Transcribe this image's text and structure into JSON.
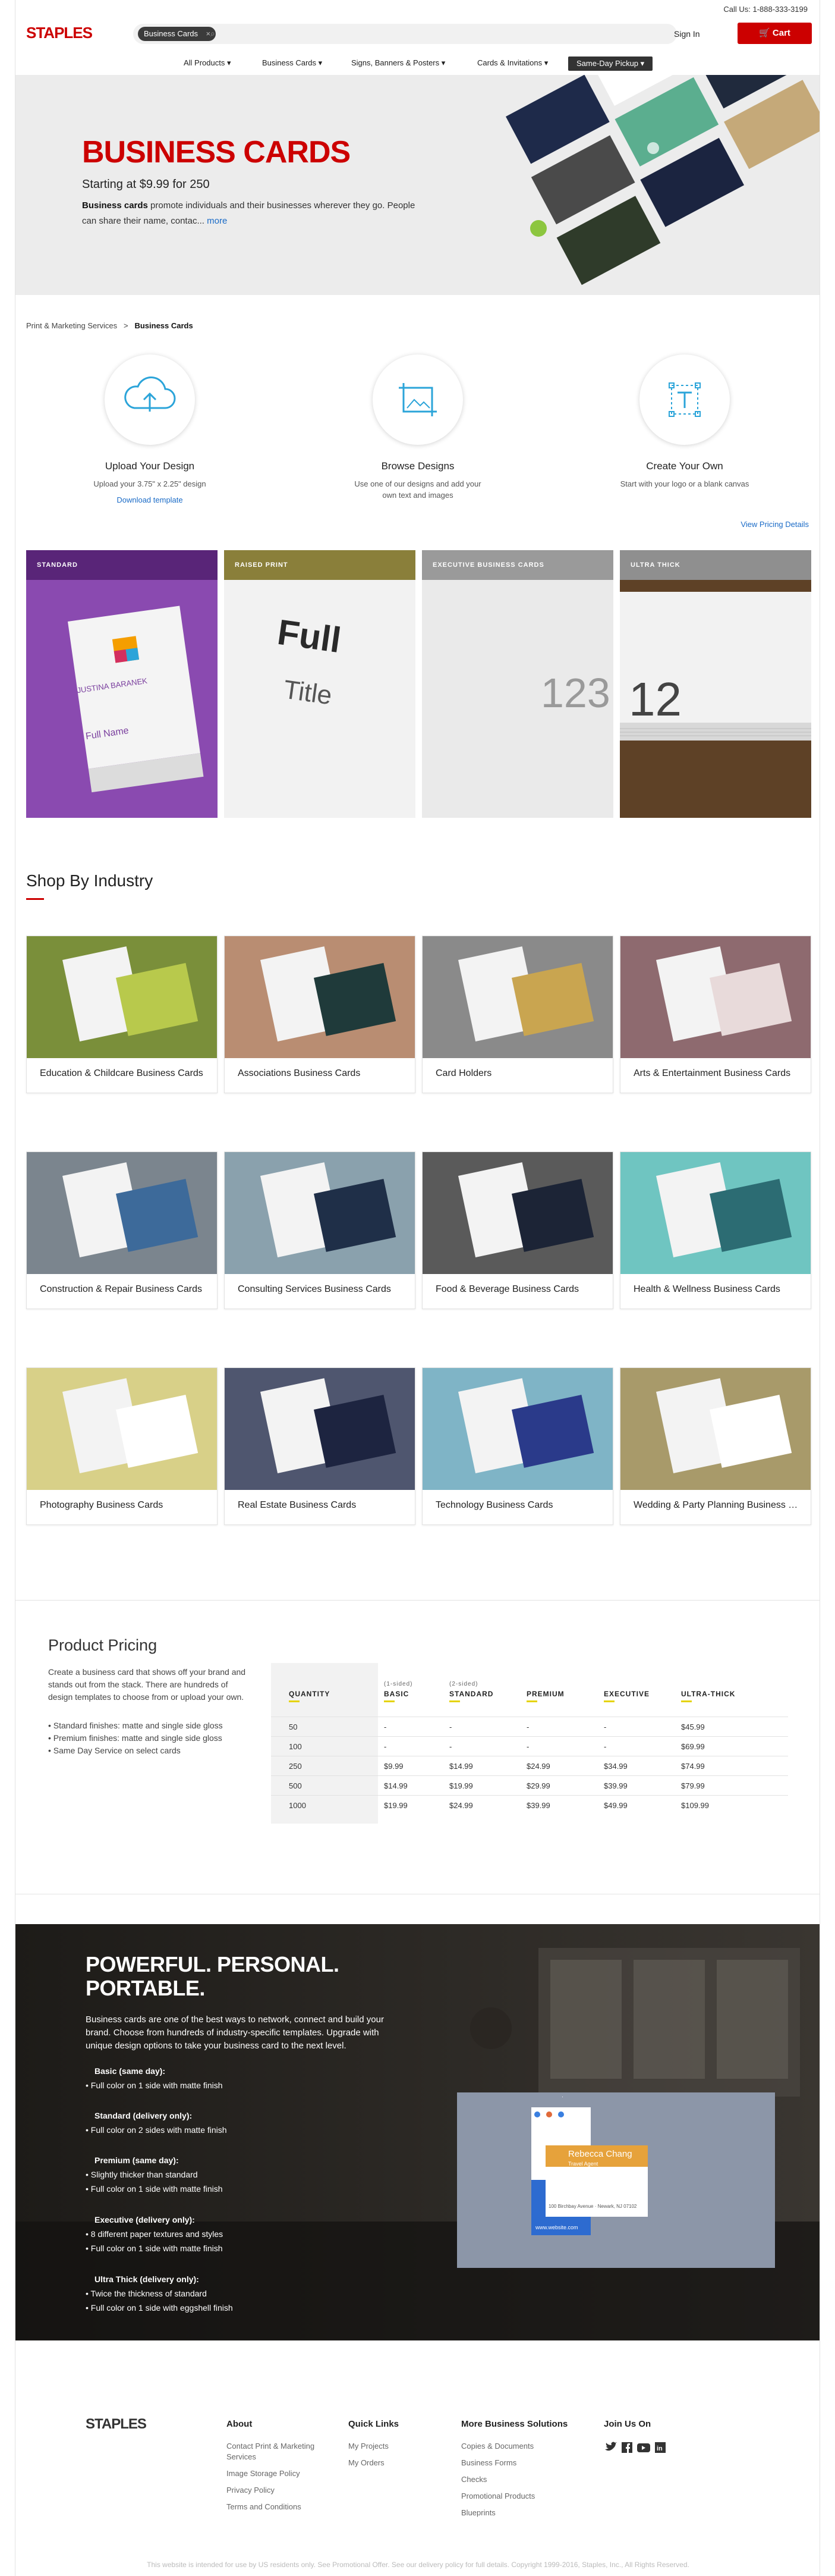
{
  "header": {
    "call_us": "Call Us: 1-888-333-3199",
    "logo": "STAPLES",
    "search_chip": "Business Cards",
    "search_chip_clear": "×",
    "sign_in": "Sign In",
    "cart": "Cart"
  },
  "nav": {
    "items": [
      "All Products ▾",
      "Business Cards ▾",
      "Signs, Banners & Posters ▾",
      "Cards & Invitations ▾"
    ],
    "same_day": "Same-Day Pickup ▾"
  },
  "hero": {
    "title": "BUSINESS CARDS",
    "price": "Starting at $9.99 for 250",
    "desc_bold": "Business cards",
    "desc_rest": " promote individuals and their businesses wherever they go. People can share their name, contac...",
    "more": "more"
  },
  "breadcrumb": {
    "parent": "Print & Marketing Services",
    "sep": ">",
    "current": "Business Cards"
  },
  "options": [
    {
      "title": "Upload Your Design",
      "sub": "Upload your 3.75\" x 2.25\" design",
      "link": "Download template"
    },
    {
      "title": "Browse Designs",
      "sub": "Use one of our designs and add your own text and images",
      "link": ""
    },
    {
      "title": "Create Your Own",
      "sub": "Start with your logo or a blank canvas",
      "link": ""
    }
  ],
  "view_pricing": "View Pricing Details",
  "paper": [
    "STANDARD",
    "RAISED PRINT",
    "EXECUTIVE BUSINESS CARDS",
    "ULTRA THICK"
  ],
  "paper_sample": {
    "name": "JUSTINA BARANEK",
    "full": "Full",
    "title": "Title",
    "name2": "Full Name",
    "num": "123",
    "num2": "12"
  },
  "industry": {
    "title": "Shop By Industry",
    "items": [
      "Education & Childcare Business Cards",
      "Associations Business Cards",
      "Card Holders",
      "Arts & Entertainment Business Cards",
      "Construction & Repair Business Cards",
      "Consulting Services Business Cards",
      "Food & Beverage Business Cards",
      "Health & Wellness Business Cards",
      "Photography Business Cards",
      "Real Estate Business Cards",
      "Technology Business Cards",
      "Wedding & Party Planning Business Cards"
    ]
  },
  "pricing": {
    "title": "Product Pricing",
    "desc": "Create a business card that shows off your brand and stands out from the stack. There are hundreds of design templates to choose from or upload your own.",
    "bullets": [
      "• Standard finishes: matte and single side gloss",
      "• Premium finishes: matte and single side gloss",
      "• Same Day Service on select cards"
    ],
    "headers": [
      "QUANTITY",
      "BASIC",
      "STANDARD",
      "PREMIUM",
      "EXECUTIVE",
      "ULTRA-THICK"
    ],
    "subheaders": [
      "",
      "(1-sided)",
      "(2-sided)",
      "",
      "",
      ""
    ],
    "rows": [
      [
        "50",
        "-",
        "-",
        "-",
        "-",
        "$45.99"
      ],
      [
        "100",
        "-",
        "-",
        "-",
        "-",
        "$69.99"
      ],
      [
        "250",
        "$9.99",
        "$14.99",
        "$24.99",
        "$34.99",
        "$74.99"
      ],
      [
        "500",
        "$14.99",
        "$19.99",
        "$29.99",
        "$39.99",
        "$79.99"
      ],
      [
        "1000",
        "$19.99",
        "$24.99",
        "$39.99",
        "$49.99",
        "$109.99"
      ]
    ]
  },
  "powerful": {
    "title": "POWERFUL. PERSONAL. PORTABLE.",
    "desc": "Business cards are one of the best ways to network, connect and build your brand. Choose from hundreds of industry-specific templates. Upgrade with unique design options to take your business card to the next level.",
    "groups": [
      {
        "name": "Basic (same day):",
        "lines": [
          "• Full color on 1 side with matte finish"
        ]
      },
      {
        "name": "Standard (delivery only):",
        "lines": [
          "• Full color on 2 sides with matte finish"
        ]
      },
      {
        "name": "Premium (same day):",
        "lines": [
          "• Slightly thicker than standard",
          "• Full color on 1 side with matte finish"
        ]
      },
      {
        "name": "Executive (delivery only):",
        "lines": [
          "• 8 different paper textures and styles",
          "• Full color on 1 side with matte finish"
        ]
      },
      {
        "name": "Ultra Thick (delivery only):",
        "lines": [
          "• Twice the thickness of standard",
          "• Full color on 1 side with eggshell finish"
        ]
      }
    ],
    "card_name": "Rebecca Chang",
    "card_title": "Travel Agent",
    "card_url": "www.website.com",
    "card_addr": "100 Birchbay Avenue · Newark, NJ 07102"
  },
  "footer": {
    "logo": "STAPLES",
    "about": {
      "title": "About",
      "links": [
        "Contact Print & Marketing Services",
        "Image Storage Policy",
        "Privacy Policy",
        "Terms and Conditions"
      ]
    },
    "quick": {
      "title": "Quick Links",
      "links": [
        "My Projects",
        "My Orders"
      ]
    },
    "more": {
      "title": "More Business Solutions",
      "links": [
        "Copies & Documents",
        "Business Forms",
        "Checks",
        "Promotional Products",
        "Blueprints"
      ]
    },
    "join": {
      "title": "Join Us On"
    },
    "legal": "This website is intended for use by US residents only. See Promotional Offer. See our delivery policy for full details. Copyright 1999-2016, Staples, Inc., All Rights Reserved."
  }
}
